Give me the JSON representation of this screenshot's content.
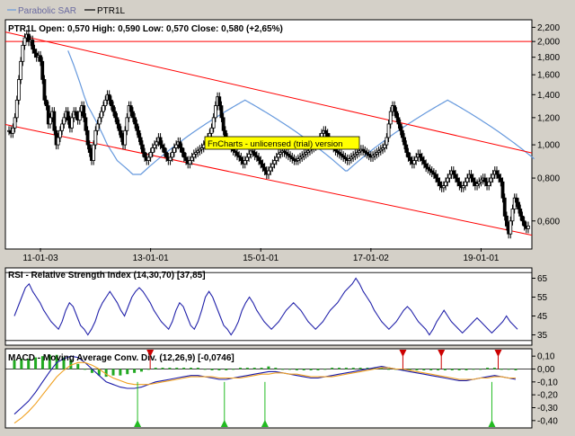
{
  "legend": {
    "items": [
      {
        "label": "Parabolic SAR",
        "color": "#6699dd"
      },
      {
        "label": "PTR1L",
        "color": "#000000"
      }
    ]
  },
  "watermark": "FnCharts - unlicensed (trial) version",
  "colors": {
    "background": "#ffffff",
    "frame": "#d4d0c8",
    "price": "#000000",
    "sar": "#6699dd",
    "channel": "#ff0000",
    "rsi": "#2222aa",
    "macd": "#1a1aa8",
    "signal": "#f0a020",
    "histogram": "#22aa22",
    "sell_marker": "#cc0000",
    "buy_marker": "#22bb22",
    "watermark_bg": "#ffff00"
  },
  "chart_data": [
    {
      "type": "candlestick",
      "title": "PTR1L",
      "header": {
        "symbol": "PTR1L",
        "open_label": "Open:",
        "open": "0,570",
        "high_label": "High:",
        "high": "0,590",
        "low_label": "Low:",
        "low": "0,570",
        "close_label": "Close:",
        "close": "0,580",
        "change": "(+2,65%)"
      },
      "y_scale": "log",
      "ylim": [
        0.5,
        2.3
      ],
      "yticks": [
        0.6,
        0.8,
        1.0,
        1.2,
        1.4,
        1.6,
        1.8,
        2.0,
        2.2
      ],
      "ytick_labels": [
        "0,600",
        "0,800",
        "1,000",
        "1,200",
        "1,400",
        "1,600",
        "1,800",
        "2,000",
        "2,200"
      ],
      "x_tick_labels": [
        "11-01-03",
        "13-01-01",
        "15-01-01",
        "17-01-02",
        "19-01-01"
      ],
      "x_tick_index": [
        16,
        72,
        128,
        184,
        240
      ],
      "close": [
        1.1,
        1.08,
        1.12,
        1.2,
        1.35,
        1.55,
        1.75,
        1.95,
        2.05,
        2.1,
        2.0,
        2.02,
        1.9,
        1.85,
        1.8,
        1.82,
        1.75,
        1.55,
        1.35,
        1.3,
        1.15,
        1.2,
        1.25,
        1.1,
        1.0,
        1.05,
        1.1,
        1.15,
        1.2,
        1.25,
        1.18,
        1.12,
        1.2,
        1.25,
        1.22,
        1.18,
        1.25,
        1.3,
        1.2,
        1.1,
        1.0,
        0.95,
        0.9,
        1.0,
        1.1,
        1.15,
        1.2,
        1.25,
        1.3,
        1.35,
        1.4,
        1.35,
        1.3,
        1.25,
        1.2,
        1.15,
        1.1,
        1.05,
        1.0,
        1.1,
        1.2,
        1.3,
        1.25,
        1.2,
        1.15,
        1.1,
        1.05,
        1.0,
        0.95,
        0.92,
        0.9,
        0.92,
        0.95,
        0.98,
        1.0,
        1.02,
        1.05,
        1.0,
        0.98,
        0.95,
        0.92,
        0.9,
        0.92,
        0.95,
        0.98,
        1.0,
        1.02,
        0.98,
        0.95,
        0.92,
        0.9,
        0.88,
        0.9,
        0.92,
        0.94,
        0.95,
        0.96,
        0.97,
        0.98,
        1.0,
        1.02,
        1.05,
        1.08,
        1.12,
        1.2,
        1.3,
        1.38,
        1.3,
        1.2,
        1.1,
        1.05,
        1.02,
        1.0,
        0.98,
        0.96,
        0.95,
        0.93,
        0.92,
        0.9,
        0.88,
        0.9,
        0.92,
        0.94,
        0.96,
        0.95,
        0.93,
        0.92,
        0.9,
        0.88,
        0.86,
        0.84,
        0.82,
        0.84,
        0.86,
        0.88,
        0.9,
        0.92,
        0.94,
        0.95,
        0.96,
        0.95,
        0.94,
        0.93,
        0.92,
        0.91,
        0.9,
        0.9,
        0.91,
        0.92,
        0.93,
        0.94,
        0.95,
        0.96,
        0.97,
        0.98,
        0.99,
        1.0,
        1.02,
        1.05,
        1.08,
        1.1,
        1.08,
        1.05,
        1.02,
        1.0,
        0.98,
        0.96,
        0.95,
        0.94,
        0.93,
        0.92,
        0.91,
        0.9,
        0.91,
        0.92,
        0.93,
        0.94,
        0.95,
        0.96,
        0.97,
        0.96,
        0.95,
        0.94,
        0.93,
        0.92,
        0.93,
        0.94,
        0.95,
        0.96,
        0.97,
        0.98,
        1.0,
        1.05,
        1.15,
        1.25,
        1.3,
        1.25,
        1.2,
        1.15,
        1.1,
        1.05,
        1.0,
        0.95,
        0.92,
        0.9,
        0.88,
        0.9,
        0.92,
        0.94,
        0.92,
        0.9,
        0.88,
        0.86,
        0.85,
        0.84,
        0.83,
        0.82,
        0.8,
        0.78,
        0.76,
        0.75,
        0.76,
        0.78,
        0.8,
        0.82,
        0.84,
        0.82,
        0.8,
        0.78,
        0.76,
        0.75,
        0.76,
        0.78,
        0.8,
        0.82,
        0.8,
        0.78,
        0.76,
        0.77,
        0.78,
        0.79,
        0.8,
        0.78,
        0.76,
        0.78,
        0.8,
        0.82,
        0.84,
        0.82,
        0.8,
        0.78,
        0.7,
        0.62,
        0.58,
        0.55,
        0.6,
        0.65,
        0.7,
        0.68,
        0.65,
        0.62,
        0.6,
        0.58,
        0.57,
        0.58
      ],
      "sar": [
        null,
        null,
        null,
        null,
        null,
        null,
        null,
        null,
        null,
        null,
        null,
        null,
        null,
        null,
        null,
        null,
        null,
        null,
        null,
        null,
        null,
        null,
        null,
        null,
        null,
        null,
        null,
        null,
        null,
        null,
        1.88,
        1.82,
        1.76,
        1.7,
        1.64,
        1.58,
        1.52,
        1.46,
        1.4,
        1.35,
        1.3,
        1.27,
        1.24,
        1.21,
        1.18,
        1.15,
        1.12,
        1.09,
        1.06,
        1.03,
        1.0,
        0.98,
        0.96,
        0.94,
        0.92,
        0.9,
        0.89,
        0.88,
        0.87,
        0.86,
        0.85,
        0.84,
        0.83,
        0.82,
        0.82,
        0.82,
        0.82,
        0.82,
        0.83,
        0.84,
        0.85,
        0.86,
        0.87,
        0.88,
        0.89,
        0.9,
        0.91,
        0.92,
        0.93,
        0.94,
        0.95,
        0.96,
        0.97,
        0.98,
        0.99,
        1.0,
        1.01,
        1.02,
        1.03,
        1.04,
        1.05,
        1.06,
        1.07,
        1.08,
        1.09,
        1.1,
        1.11,
        1.12,
        1.13,
        1.14,
        1.15,
        1.16,
        1.17,
        1.18,
        1.19,
        1.2,
        1.21,
        1.22,
        1.23,
        1.24,
        1.25,
        1.26,
        1.27,
        1.28,
        1.29,
        1.3,
        1.31,
        1.32,
        1.33,
        1.34,
        1.35,
        1.34,
        1.33,
        1.32,
        1.31,
        1.3,
        1.29,
        1.28,
        1.27,
        1.26,
        1.25,
        1.24,
        1.23,
        1.22,
        1.21,
        1.2,
        1.19,
        1.18,
        1.17,
        1.16,
        1.15,
        1.14,
        1.13,
        1.12,
        1.11,
        1.1,
        1.09,
        1.08,
        1.07,
        1.06,
        1.05,
        1.04,
        1.03,
        1.02,
        1.01,
        1.0,
        0.99,
        0.98,
        0.97,
        0.96,
        0.95,
        0.94,
        0.93,
        0.92,
        0.91,
        0.9,
        0.89,
        0.88,
        0.87,
        0.86,
        0.85,
        0.84,
        0.84,
        0.85,
        0.86,
        0.87,
        0.88,
        0.89,
        0.9,
        0.91,
        0.92,
        0.93,
        0.94,
        0.95,
        0.96,
        0.97,
        0.98,
        0.99,
        1.0,
        1.01,
        1.02,
        1.03,
        1.04,
        1.05,
        1.06,
        1.07,
        1.08,
        1.09,
        1.1,
        1.11,
        1.12,
        1.13,
        1.14,
        1.15,
        1.16,
        1.17,
        1.18,
        1.19,
        1.2,
        1.21,
        1.22,
        1.23,
        1.24,
        1.25,
        1.26,
        1.27,
        1.28,
        1.29,
        1.3,
        1.31,
        1.32,
        1.33,
        1.34,
        1.35,
        1.34,
        1.33,
        1.32,
        1.31,
        1.3,
        1.29,
        1.28,
        1.27,
        1.26,
        1.25,
        1.24,
        1.23,
        1.22,
        1.21,
        1.2,
        1.19,
        1.18,
        1.17,
        1.16,
        1.15,
        1.14,
        1.13,
        1.12,
        1.11,
        1.1,
        1.09,
        1.08,
        1.07,
        1.06,
        1.05,
        1.04,
        1.03,
        1.02,
        1.01,
        1.0,
        0.99,
        0.98,
        0.97,
        0.96,
        0.95,
        0.94,
        0.93,
        0.92,
        0.91
      ],
      "horizontal_line": 2.0,
      "channel_upper": [
        {
          "x": 0,
          "y": 2.12
        },
        {
          "x": 290,
          "y": 0.88
        }
      ],
      "channel_lower": [
        {
          "x": 0,
          "y": 1.14
        },
        {
          "x": 290,
          "y": 0.51
        }
      ]
    },
    {
      "type": "line",
      "title": "RSI - Relative Strength Index (14,30,70) [37,85]",
      "ylim": [
        30,
        70
      ],
      "yticks": [
        35,
        45,
        55,
        65
      ],
      "ytick_labels": [
        "35",
        "45",
        "55",
        "65"
      ],
      "values": [
        45,
        50,
        55,
        60,
        62,
        58,
        55,
        52,
        48,
        45,
        42,
        40,
        38,
        42,
        48,
        52,
        50,
        45,
        40,
        38,
        35,
        38,
        42,
        48,
        52,
        55,
        58,
        55,
        52,
        48,
        45,
        50,
        55,
        58,
        60,
        58,
        55,
        52,
        48,
        45,
        42,
        40,
        38,
        42,
        48,
        52,
        50,
        45,
        40,
        38,
        42,
        48,
        55,
        58,
        55,
        50,
        45,
        40,
        38,
        35,
        38,
        42,
        48,
        52,
        55,
        52,
        48,
        45,
        42,
        40,
        38,
        40,
        42,
        45,
        48,
        50,
        52,
        50,
        48,
        45,
        42,
        40,
        38,
        40,
        42,
        45,
        48,
        50,
        52,
        55,
        58,
        60,
        62,
        65,
        62,
        58,
        55,
        52,
        48,
        45,
        42,
        40,
        38,
        40,
        42,
        45,
        48,
        50,
        48,
        45,
        42,
        40,
        38,
        35,
        38,
        42,
        45,
        48,
        45,
        42,
        40,
        38,
        36,
        38,
        40,
        42,
        44,
        42,
        40,
        38,
        36,
        38,
        40,
        42,
        45,
        42,
        40,
        38
      ]
    },
    {
      "type": "line",
      "title": "MACD - Moving Average Conv. Div. (12,26,9) [-0,0746]",
      "ylim": [
        -0.45,
        0.15
      ],
      "yticks": [
        -0.4,
        -0.3,
        -0.2,
        -0.1,
        0.0,
        0.1
      ],
      "ytick_labels": [
        "-0,40",
        "-0,30",
        "-0,20",
        "-0,10",
        "0,00",
        "0,10"
      ],
      "series": [
        {
          "name": "MACD",
          "values": [
            -0.35,
            -0.3,
            -0.25,
            -0.18,
            -0.1,
            -0.02,
            0.05,
            0.08,
            0.1,
            0.09,
            0.05,
            0.0,
            -0.05,
            -0.1,
            -0.12,
            -0.14,
            -0.15,
            -0.15,
            -0.14,
            -0.12,
            -0.1,
            -0.09,
            -0.08,
            -0.07,
            -0.06,
            -0.05,
            -0.05,
            -0.06,
            -0.07,
            -0.08,
            -0.08,
            -0.07,
            -0.06,
            -0.05,
            -0.04,
            -0.03,
            -0.02,
            -0.02,
            -0.03,
            -0.04,
            -0.05,
            -0.06,
            -0.07,
            -0.07,
            -0.06,
            -0.05,
            -0.04,
            -0.03,
            -0.02,
            -0.01,
            0.0,
            0.01,
            0.02,
            0.01,
            0.0,
            -0.01,
            -0.02,
            -0.03,
            -0.04,
            -0.05,
            -0.06,
            -0.07,
            -0.08,
            -0.09,
            -0.09,
            -0.08,
            -0.07,
            -0.06,
            -0.05,
            -0.06,
            -0.07,
            -0.08
          ]
        },
        {
          "name": "Signal",
          "values": [
            -0.42,
            -0.38,
            -0.33,
            -0.27,
            -0.2,
            -0.13,
            -0.06,
            -0.01,
            0.03,
            0.05,
            0.05,
            0.03,
            0.0,
            -0.04,
            -0.07,
            -0.09,
            -0.11,
            -0.12,
            -0.12,
            -0.12,
            -0.11,
            -0.1,
            -0.09,
            -0.08,
            -0.07,
            -0.06,
            -0.06,
            -0.06,
            -0.06,
            -0.07,
            -0.07,
            -0.07,
            -0.07,
            -0.06,
            -0.05,
            -0.04,
            -0.04,
            -0.03,
            -0.03,
            -0.04,
            -0.04,
            -0.05,
            -0.06,
            -0.06,
            -0.06,
            -0.06,
            -0.05,
            -0.04,
            -0.03,
            -0.02,
            -0.01,
            0.0,
            0.01,
            0.01,
            0.0,
            0.0,
            -0.01,
            -0.02,
            -0.03,
            -0.04,
            -0.05,
            -0.06,
            -0.07,
            -0.08,
            -0.08,
            -0.08,
            -0.07,
            -0.07,
            -0.06,
            -0.06,
            -0.07,
            -0.07
          ]
        }
      ],
      "histogram": [
        0.07,
        0.08,
        0.08,
        0.09,
        0.1,
        0.11,
        0.11,
        0.09,
        0.07,
        0.04,
        0.0,
        -0.03,
        -0.05,
        -0.06,
        -0.05,
        -0.05,
        -0.04,
        -0.03,
        -0.02,
        0.0,
        0.01,
        0.01,
        0.01,
        0.01,
        0.01,
        0.01,
        0.01,
        0.0,
        -0.01,
        -0.01,
        -0.01,
        0.0,
        0.01,
        0.01,
        0.01,
        0.01,
        0.02,
        0.01,
        0.0,
        0.0,
        -0.01,
        -0.01,
        -0.01,
        -0.01,
        0.0,
        0.01,
        0.01,
        0.01,
        0.01,
        0.01,
        0.01,
        0.01,
        0.01,
        0.0,
        0.0,
        -0.01,
        -0.01,
        -0.01,
        -0.01,
        -0.01,
        -0.01,
        -0.01,
        -0.01,
        -0.01,
        -0.01,
        0.0,
        0.0,
        0.01,
        0.01,
        0.0,
        0.0,
        -0.01
      ],
      "sell_signals": [
        0.275,
        0.755,
        0.828,
        0.936
      ],
      "buy_signals": [
        0.251,
        0.416,
        0.493,
        0.924
      ]
    }
  ]
}
